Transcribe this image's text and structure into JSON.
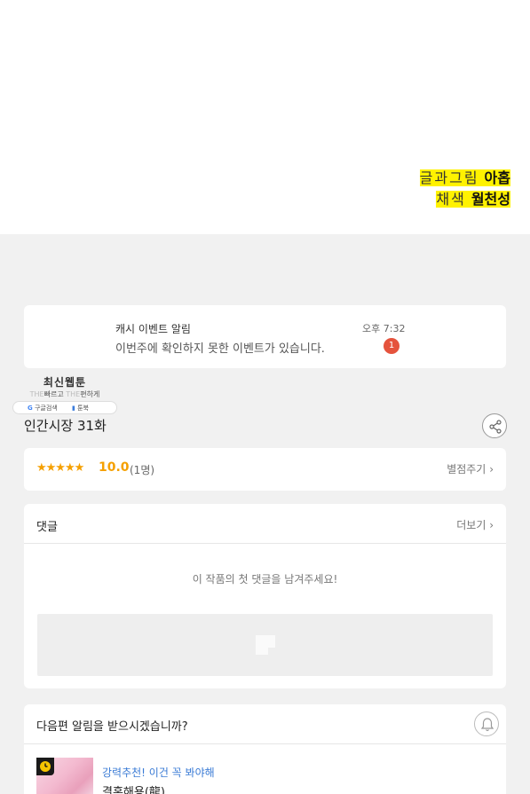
{
  "credits": {
    "story_role": "글과그림",
    "story_name": "아홉",
    "color_role": "채색",
    "color_name": "월천성"
  },
  "notification": {
    "title": "캐시 이벤트 알림",
    "message": "이번주에 확인하지 못한 이벤트가 있습니다.",
    "time": "오후 7:32",
    "badge_count": "1"
  },
  "logo": {
    "title": "최신웹툰",
    "tag_faint_1": "THE",
    "tag_1": "빠르고",
    "tag_faint_2": "THE",
    "tag_2": "편하게",
    "google_label": "구글검색",
    "toonbook_label": "툰북"
  },
  "episode": {
    "title": "인간시장 31화"
  },
  "rating": {
    "stars": "★★★★★",
    "score": "10.0",
    "count": "(1명)",
    "rate_link": "별점주기"
  },
  "comments": {
    "title": "댓글",
    "more_label": "더보기",
    "empty_message": "이 작품의 첫 댓글을 남겨주세요!"
  },
  "next_alert": {
    "question": "다음편 알림을 받으시겠습니까?",
    "promo_label": "강력추천! 이건 꼭 봐야해",
    "recommended_title": "결혼해용(龍)"
  },
  "colors": {
    "highlight": "#fff200",
    "rating_orange": "#f5a000",
    "badge_red": "#e5533d",
    "link_blue": "#3a7bd5"
  }
}
